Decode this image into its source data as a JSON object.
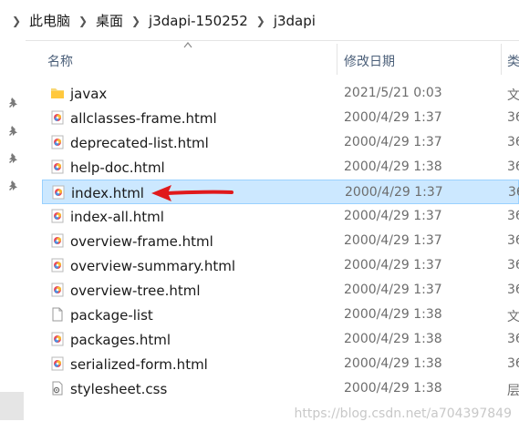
{
  "breadcrumb": [
    "此电脑",
    "桌面",
    "j3dapi-150252",
    "j3dapi"
  ],
  "columns": {
    "name": "名称",
    "date": "修改日期",
    "type": "类"
  },
  "files": [
    {
      "name": "javax",
      "date": "2021/5/21 0:03",
      "type": "文",
      "icon": "folder-icon"
    },
    {
      "name": "allclasses-frame.html",
      "date": "2000/4/29 1:37",
      "type": "36",
      "icon": "html-file-icon"
    },
    {
      "name": "deprecated-list.html",
      "date": "2000/4/29 1:37",
      "type": "36",
      "icon": "html-file-icon"
    },
    {
      "name": "help-doc.html",
      "date": "2000/4/29 1:38",
      "type": "36",
      "icon": "html-file-icon"
    },
    {
      "name": "index.html",
      "date": "2000/4/29 1:37",
      "type": "36",
      "icon": "html-file-icon"
    },
    {
      "name": "index-all.html",
      "date": "2000/4/29 1:37",
      "type": "36",
      "icon": "html-file-icon"
    },
    {
      "name": "overview-frame.html",
      "date": "2000/4/29 1:37",
      "type": "36",
      "icon": "html-file-icon"
    },
    {
      "name": "overview-summary.html",
      "date": "2000/4/29 1:37",
      "type": "36",
      "icon": "html-file-icon"
    },
    {
      "name": "overview-tree.html",
      "date": "2000/4/29 1:37",
      "type": "36",
      "icon": "html-file-icon"
    },
    {
      "name": "package-list",
      "date": "2000/4/29 1:38",
      "type": "文",
      "icon": "blank-file-icon"
    },
    {
      "name": "packages.html",
      "date": "2000/4/29 1:38",
      "type": "36",
      "icon": "html-file-icon"
    },
    {
      "name": "serialized-form.html",
      "date": "2000/4/29 1:38",
      "type": "36",
      "icon": "html-file-icon"
    },
    {
      "name": "stylesheet.css",
      "date": "2000/4/29 1:38",
      "type": "层",
      "icon": "css-file-icon"
    }
  ],
  "selected_file": "index.html",
  "watermark": "https://blog.csdn.net/a704397849",
  "colors": {
    "selection_bg": "#cce8ff",
    "selection_border": "#99d1ff",
    "arrow": "#e0191b",
    "header_text": "#4c607a"
  }
}
